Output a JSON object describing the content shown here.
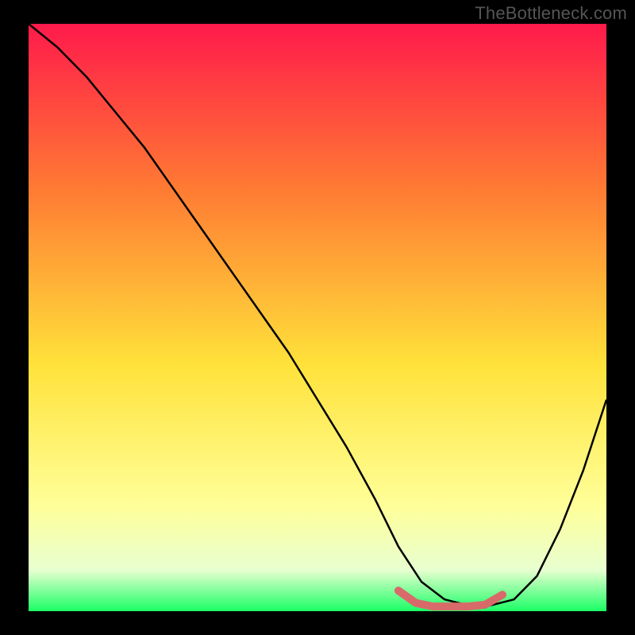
{
  "watermark": "TheBottleneck.com",
  "chart_data": {
    "type": "line",
    "title": "",
    "xlabel": "",
    "ylabel": "",
    "xlim": [
      0,
      100
    ],
    "ylim": [
      0,
      100
    ],
    "grid": false,
    "background_gradient": [
      "#ff1a4b",
      "#ff7a33",
      "#ffe23a",
      "#ffff99",
      "#e8ffd0",
      "#1aff66"
    ],
    "series": [
      {
        "name": "bottleneck-curve",
        "x": [
          0,
          5,
          10,
          15,
          20,
          25,
          30,
          35,
          40,
          45,
          50,
          55,
          60,
          64,
          68,
          72,
          76,
          80,
          84,
          88,
          92,
          96,
          100
        ],
        "values": [
          100,
          96,
          91,
          85,
          79,
          72,
          65,
          58,
          51,
          44,
          36,
          28,
          19,
          11,
          5,
          2,
          1,
          1,
          2,
          6,
          14,
          24,
          36
        ]
      },
      {
        "name": "optimal-range-marker",
        "x": [
          64,
          67,
          70,
          73,
          76,
          79,
          82
        ],
        "values": [
          3.5,
          1.4,
          0.8,
          0.8,
          0.8,
          1.1,
          2.8
        ]
      }
    ],
    "styles": {
      "bottleneck-curve": {
        "stroke": "#000000",
        "stroke_width": 2.5
      },
      "optimal-range-marker": {
        "stroke": "#d86a6a",
        "stroke_width": 10,
        "linecap": "round"
      }
    }
  }
}
